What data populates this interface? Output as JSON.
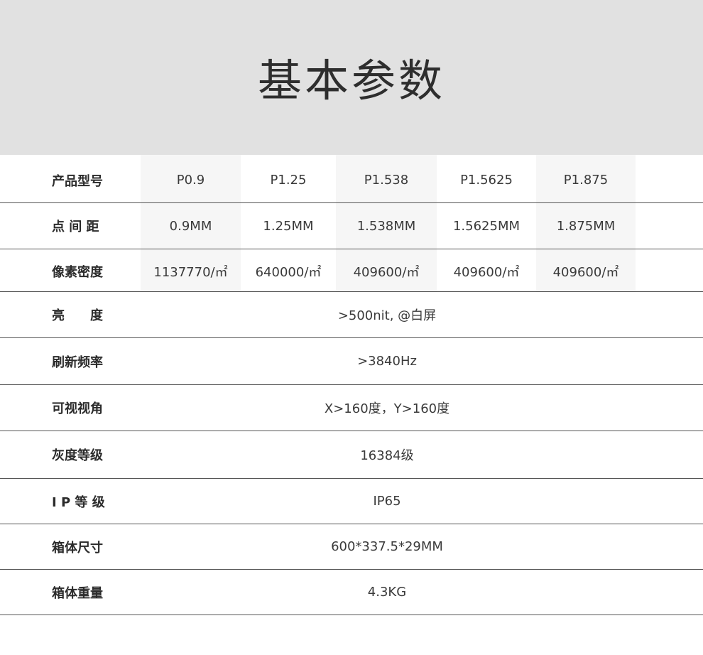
{
  "title": "基本参数",
  "model_row": {
    "label": "产品型号",
    "values": [
      "P0.9",
      "P1.25",
      "P1.538",
      "P1.5625",
      "P1.875"
    ]
  },
  "pitch_row": {
    "label": "点 间 距",
    "values": [
      "0.9MM",
      "1.25MM",
      "1.538MM",
      "1.5625MM",
      "1.875MM"
    ]
  },
  "density_row": {
    "label": "像素密度",
    "values": [
      "1137770/㎡",
      "640000/㎡",
      "409600/㎡",
      "409600/㎡",
      "409600/㎡"
    ]
  },
  "shared_rows": [
    {
      "label": "亮　　度",
      "value": ">500nit, @白屏"
    },
    {
      "label": "刷新频率",
      "value": ">3840Hz"
    },
    {
      "label": "可视视角",
      "value": "X>160度，Y>160度"
    },
    {
      "label": "灰度等级",
      "value": "16384级"
    },
    {
      "label": "I P 等 级",
      "value": "IP65"
    },
    {
      "label": "箱体尺寸",
      "value": "600*337.5*29MM"
    },
    {
      "label": "箱体重量",
      "value": "4.3KG"
    }
  ],
  "colors": {
    "header_bg": "#e1e1e1",
    "alt_column_bg": "#f6f6f6",
    "divider": "#555555"
  }
}
